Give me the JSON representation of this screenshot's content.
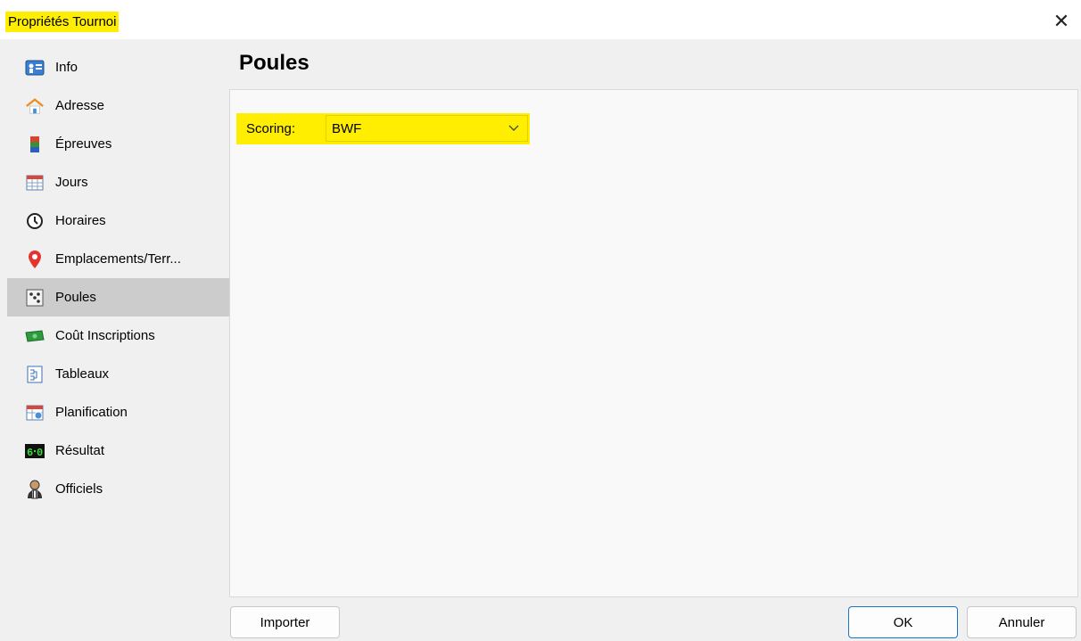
{
  "window": {
    "title": "Propriétés Tournoi",
    "close_symbol": "✕"
  },
  "sidebar": {
    "items": [
      {
        "label": "Info",
        "icon": "info-icon"
      },
      {
        "label": "Adresse",
        "icon": "house-icon"
      },
      {
        "label": "Épreuves",
        "icon": "events-icon"
      },
      {
        "label": "Jours",
        "icon": "calendar-icon"
      },
      {
        "label": "Horaires",
        "icon": "clock-icon"
      },
      {
        "label": "Emplacements/Terr...",
        "icon": "location-pin-icon"
      },
      {
        "label": "Poules",
        "icon": "dice-icon",
        "active": true
      },
      {
        "label": "Coût Inscriptions",
        "icon": "money-icon"
      },
      {
        "label": "Tableaux",
        "icon": "draw-sheet-icon"
      },
      {
        "label": "Planification",
        "icon": "planning-icon"
      },
      {
        "label": "Résultat",
        "icon": "scoreboard-icon"
      },
      {
        "label": "Officiels",
        "icon": "official-icon"
      }
    ]
  },
  "main": {
    "title": "Poules",
    "scoring": {
      "label": "Scoring:",
      "value": "BWF"
    }
  },
  "footer": {
    "import_label": "Importer",
    "ok_label": "OK",
    "cancel_label": "Annuler"
  },
  "colors": {
    "highlight": "#ffee00",
    "active_item": "#cccccc",
    "ok_border": "#1a73c8"
  }
}
